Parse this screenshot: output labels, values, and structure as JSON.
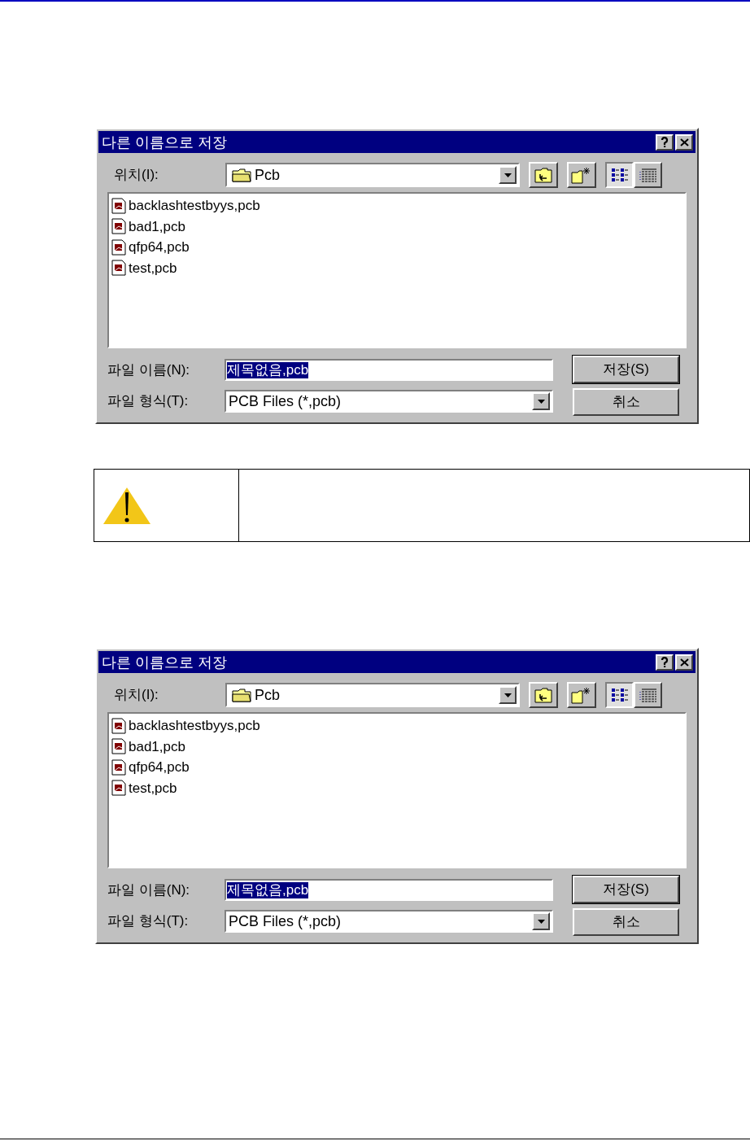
{
  "dialogs": [
    {
      "title": "다른 이름으로 저장",
      "location_label": "위치(I):",
      "location_value": "Pcb",
      "view_modes": [
        {
          "kind": "list",
          "selected": true
        },
        {
          "kind": "details",
          "selected": false
        }
      ],
      "files": [
        "backlashtestbyys,pcb",
        "bad1,pcb",
        "qfp64,pcb",
        "test,pcb"
      ],
      "filename_label": "파일 이름(N):",
      "filename_value": "제목없음,pcb",
      "filetype_label": "파일 형식(T):",
      "filetype_value": "PCB Files (*,pcb)",
      "buttons": [
        "저장(S)",
        "취소"
      ]
    },
    {
      "title": "다른 이름으로 저장",
      "location_label": "위치(I):",
      "location_value": "Pcb",
      "view_modes": [
        {
          "kind": "list",
          "selected": true
        },
        {
          "kind": "details",
          "selected": false
        }
      ],
      "files": [
        "backlashtestbyys,pcb",
        "bad1,pcb",
        "qfp64,pcb",
        "test,pcb"
      ],
      "filename_label": "파일 이름(N):",
      "filename_value": "제목없음,pcb",
      "filetype_label": "파일 형식(T):",
      "filetype_value": "PCB Files (*,pcb)",
      "buttons": [
        "저장(S)",
        "취소"
      ]
    }
  ],
  "note": {
    "kind": "warning"
  }
}
